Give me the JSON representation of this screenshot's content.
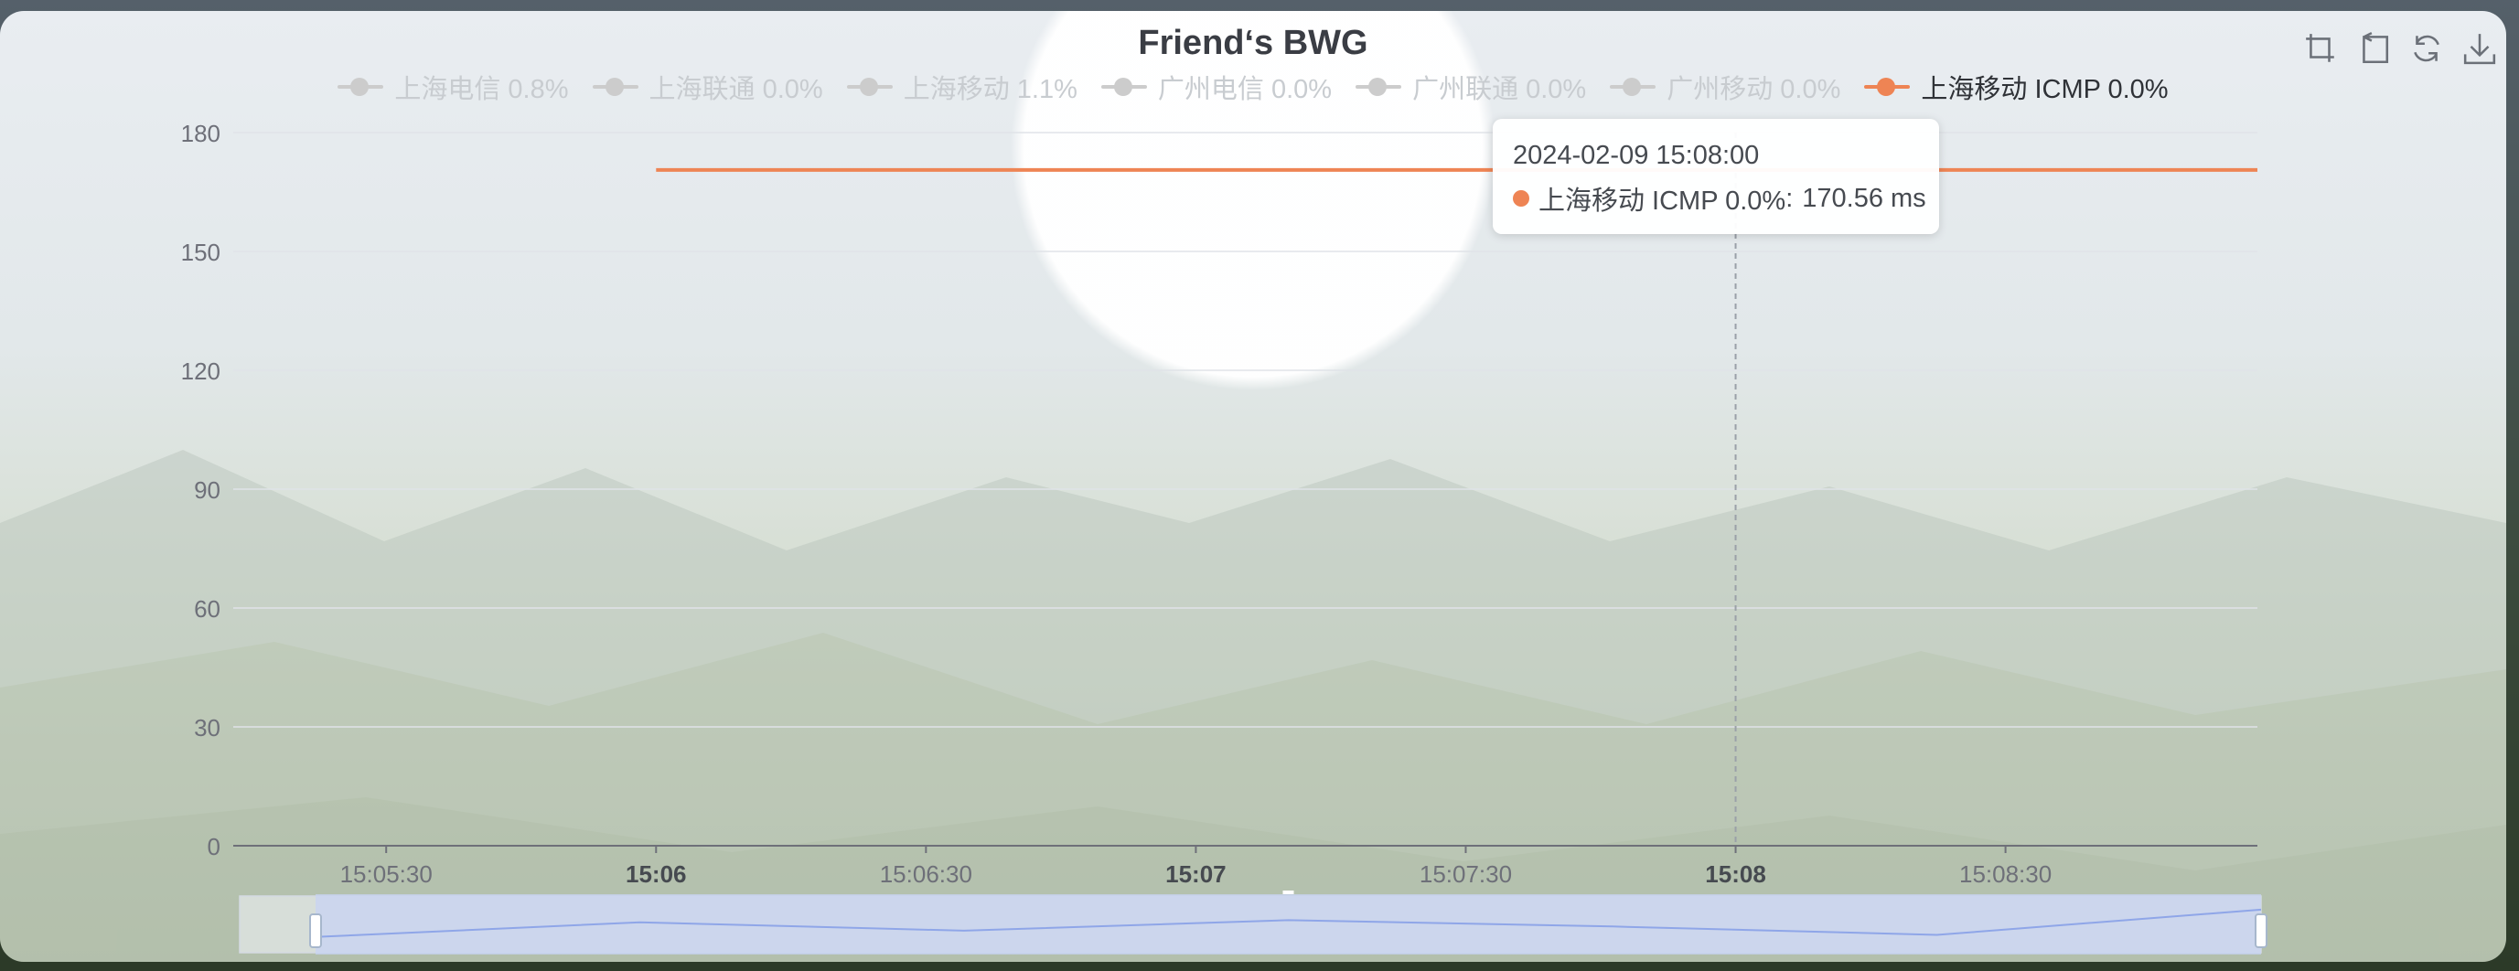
{
  "colors": {
    "active_series": "#ee8454",
    "inactive": "#cccccc",
    "axis": "#6e7079",
    "grid": "#e0e3e8",
    "zoom_fill": "#c7d3f5",
    "zoom_line": "#8fa6e8"
  },
  "toolbox": [
    {
      "icon": "zoom-select-icon"
    },
    {
      "icon": "zoom-back-icon"
    },
    {
      "icon": "restore-icon"
    },
    {
      "icon": "download-icon"
    }
  ],
  "tooltip": {
    "title": "2024-02-09 15:08:00",
    "series": "上海移动 ICMP 0.0%",
    "value": "170.56 ms"
  },
  "chart_data": {
    "type": "line",
    "title": "Friend‘s BWG",
    "xlabel": "",
    "ylabel": "",
    "ylim": [
      0,
      180
    ],
    "yticks": [
      0,
      30,
      60,
      90,
      120,
      150,
      180
    ],
    "x_range": [
      "15:05:13",
      "15:08:58"
    ],
    "xticks": [
      {
        "t": "15:05:30",
        "label": "15:05:30",
        "major": false
      },
      {
        "t": "15:06:00",
        "label": "15:06",
        "major": true
      },
      {
        "t": "15:06:30",
        "label": "15:06:30",
        "major": false
      },
      {
        "t": "15:07:00",
        "label": "15:07",
        "major": true
      },
      {
        "t": "15:07:30",
        "label": "15:07:30",
        "major": false
      },
      {
        "t": "15:08:00",
        "label": "15:08",
        "major": true
      },
      {
        "t": "15:08:30",
        "label": "15:08:30",
        "major": false
      }
    ],
    "series": [
      {
        "name": "上海电信 0.8%",
        "active": false,
        "points": []
      },
      {
        "name": "上海联通 0.0%",
        "active": false,
        "points": []
      },
      {
        "name": "上海移动 1.1%",
        "active": false,
        "points": []
      },
      {
        "name": "广州电信 0.0%",
        "active": false,
        "points": []
      },
      {
        "name": "广州联通 0.0%",
        "active": false,
        "points": []
      },
      {
        "name": "广州移动 0.0%",
        "active": false,
        "points": []
      },
      {
        "name": "上海移动 ICMP 0.0%",
        "active": true,
        "points": [
          {
            "t": "15:06:00",
            "v": 170.56
          },
          {
            "t": "15:06:30",
            "v": 170.56
          },
          {
            "t": "15:07:00",
            "v": 170.56
          },
          {
            "t": "15:07:30",
            "v": 170.56
          },
          {
            "t": "15:08:00",
            "v": 170.56
          },
          {
            "t": "15:08:30",
            "v": 170.56
          },
          {
            "t": "15:08:58",
            "v": 170.56
          }
        ]
      }
    ],
    "pointer": "15:08:00",
    "legend_position": "top-center",
    "grid": true,
    "data_zoom": {
      "start_percent": 0,
      "end_percent": 100,
      "overview": [
        0.2,
        0.55,
        0.35,
        0.6,
        0.45,
        0.25,
        0.85
      ]
    }
  }
}
